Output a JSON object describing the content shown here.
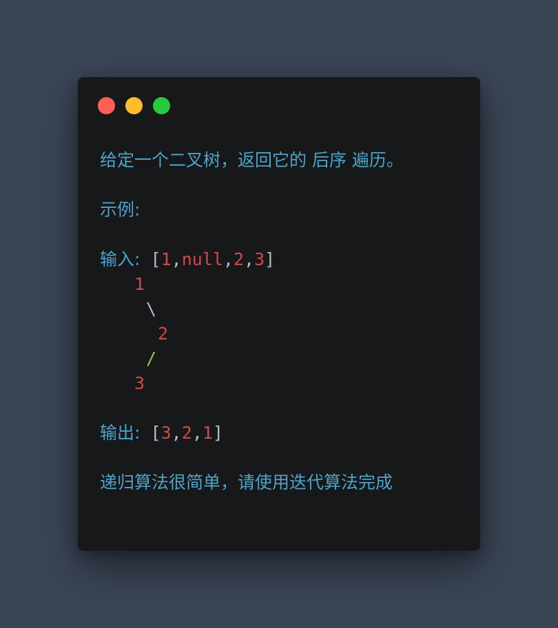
{
  "window_controls": {
    "close_color": "#ff5f56",
    "minimize_color": "#ffbd2e",
    "maximize_color": "#27c93f"
  },
  "problem": {
    "description": "给定一个二叉树，返回它的 后序 遍历。",
    "example_label": "示例:",
    "input_label": "输入:",
    "input": {
      "open": "[",
      "v1": "1",
      "c1": ",",
      "v2": "null",
      "c2": ",",
      "v3": "2",
      "c3": ",",
      "v4": "3",
      "close": "]"
    },
    "tree": {
      "node_root": "1",
      "edge_right": "\\",
      "node_right": "2",
      "edge_left": "/",
      "node_left": "3"
    },
    "output_label": "输出:",
    "output": {
      "open": "[",
      "v1": "3",
      "c1": ",",
      "v2": "2",
      "c2": ",",
      "v3": "1",
      "close": "]"
    },
    "hint": "递归算法很简单，请使用迭代算法完成"
  }
}
